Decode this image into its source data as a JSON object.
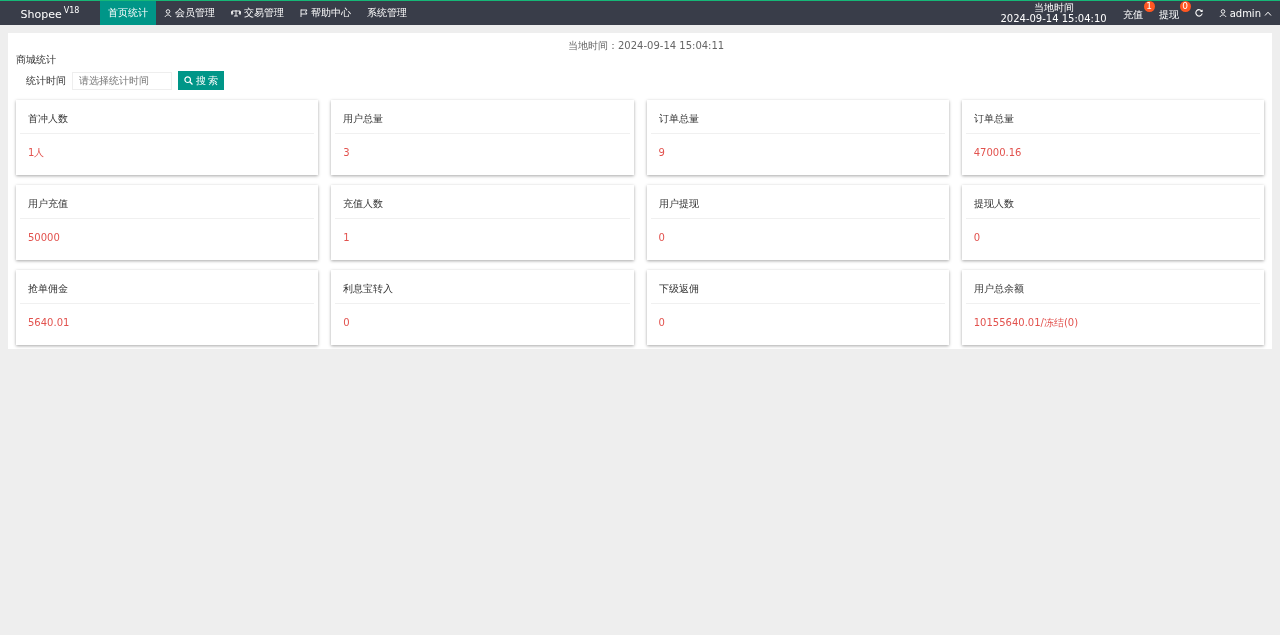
{
  "header": {
    "logo": "Shopee",
    "logo_version": "V18",
    "nav": [
      {
        "label": "首页统计",
        "kind": "plain",
        "selected": true
      },
      {
        "label": "会员管理",
        "kind": "user",
        "selected": false
      },
      {
        "label": "交易管理",
        "kind": "scale",
        "selected": false
      },
      {
        "label": "帮助中心",
        "kind": "flag",
        "selected": false
      },
      {
        "label": "系统管理",
        "kind": "plain",
        "selected": false
      }
    ],
    "time_label": "当地时间",
    "time_value": "2024-09-14 15:04:10",
    "badges": [
      {
        "label": "充值",
        "count": "1"
      },
      {
        "label": "提现",
        "count": "0"
      }
    ],
    "user": "admin"
  },
  "panel": {
    "local_time_label": "当地时间：",
    "local_time_value": "2024-09-14 15:04:11",
    "section_title": "商城统计",
    "filter_label": "统计时间",
    "filter_placeholder": "请选择统计时间",
    "search_button": "搜 索",
    "cards": [
      {
        "title": "首冲人数",
        "value": "1人"
      },
      {
        "title": "用户总量",
        "value": "3"
      },
      {
        "title": "订单总量",
        "value": "9"
      },
      {
        "title": "订单总量",
        "value": "47000.16"
      },
      {
        "title": "用户充值",
        "value": "50000"
      },
      {
        "title": "充值人数",
        "value": "1"
      },
      {
        "title": "用户提现",
        "value": "0"
      },
      {
        "title": "提现人数",
        "value": "0"
      },
      {
        "title": "抢单佣金",
        "value": "5640.01"
      },
      {
        "title": "利息宝转入",
        "value": "0"
      },
      {
        "title": "下级返佣",
        "value": "0"
      },
      {
        "title": "用户总余额",
        "value": "10155640.01/冻结(0)"
      }
    ]
  }
}
